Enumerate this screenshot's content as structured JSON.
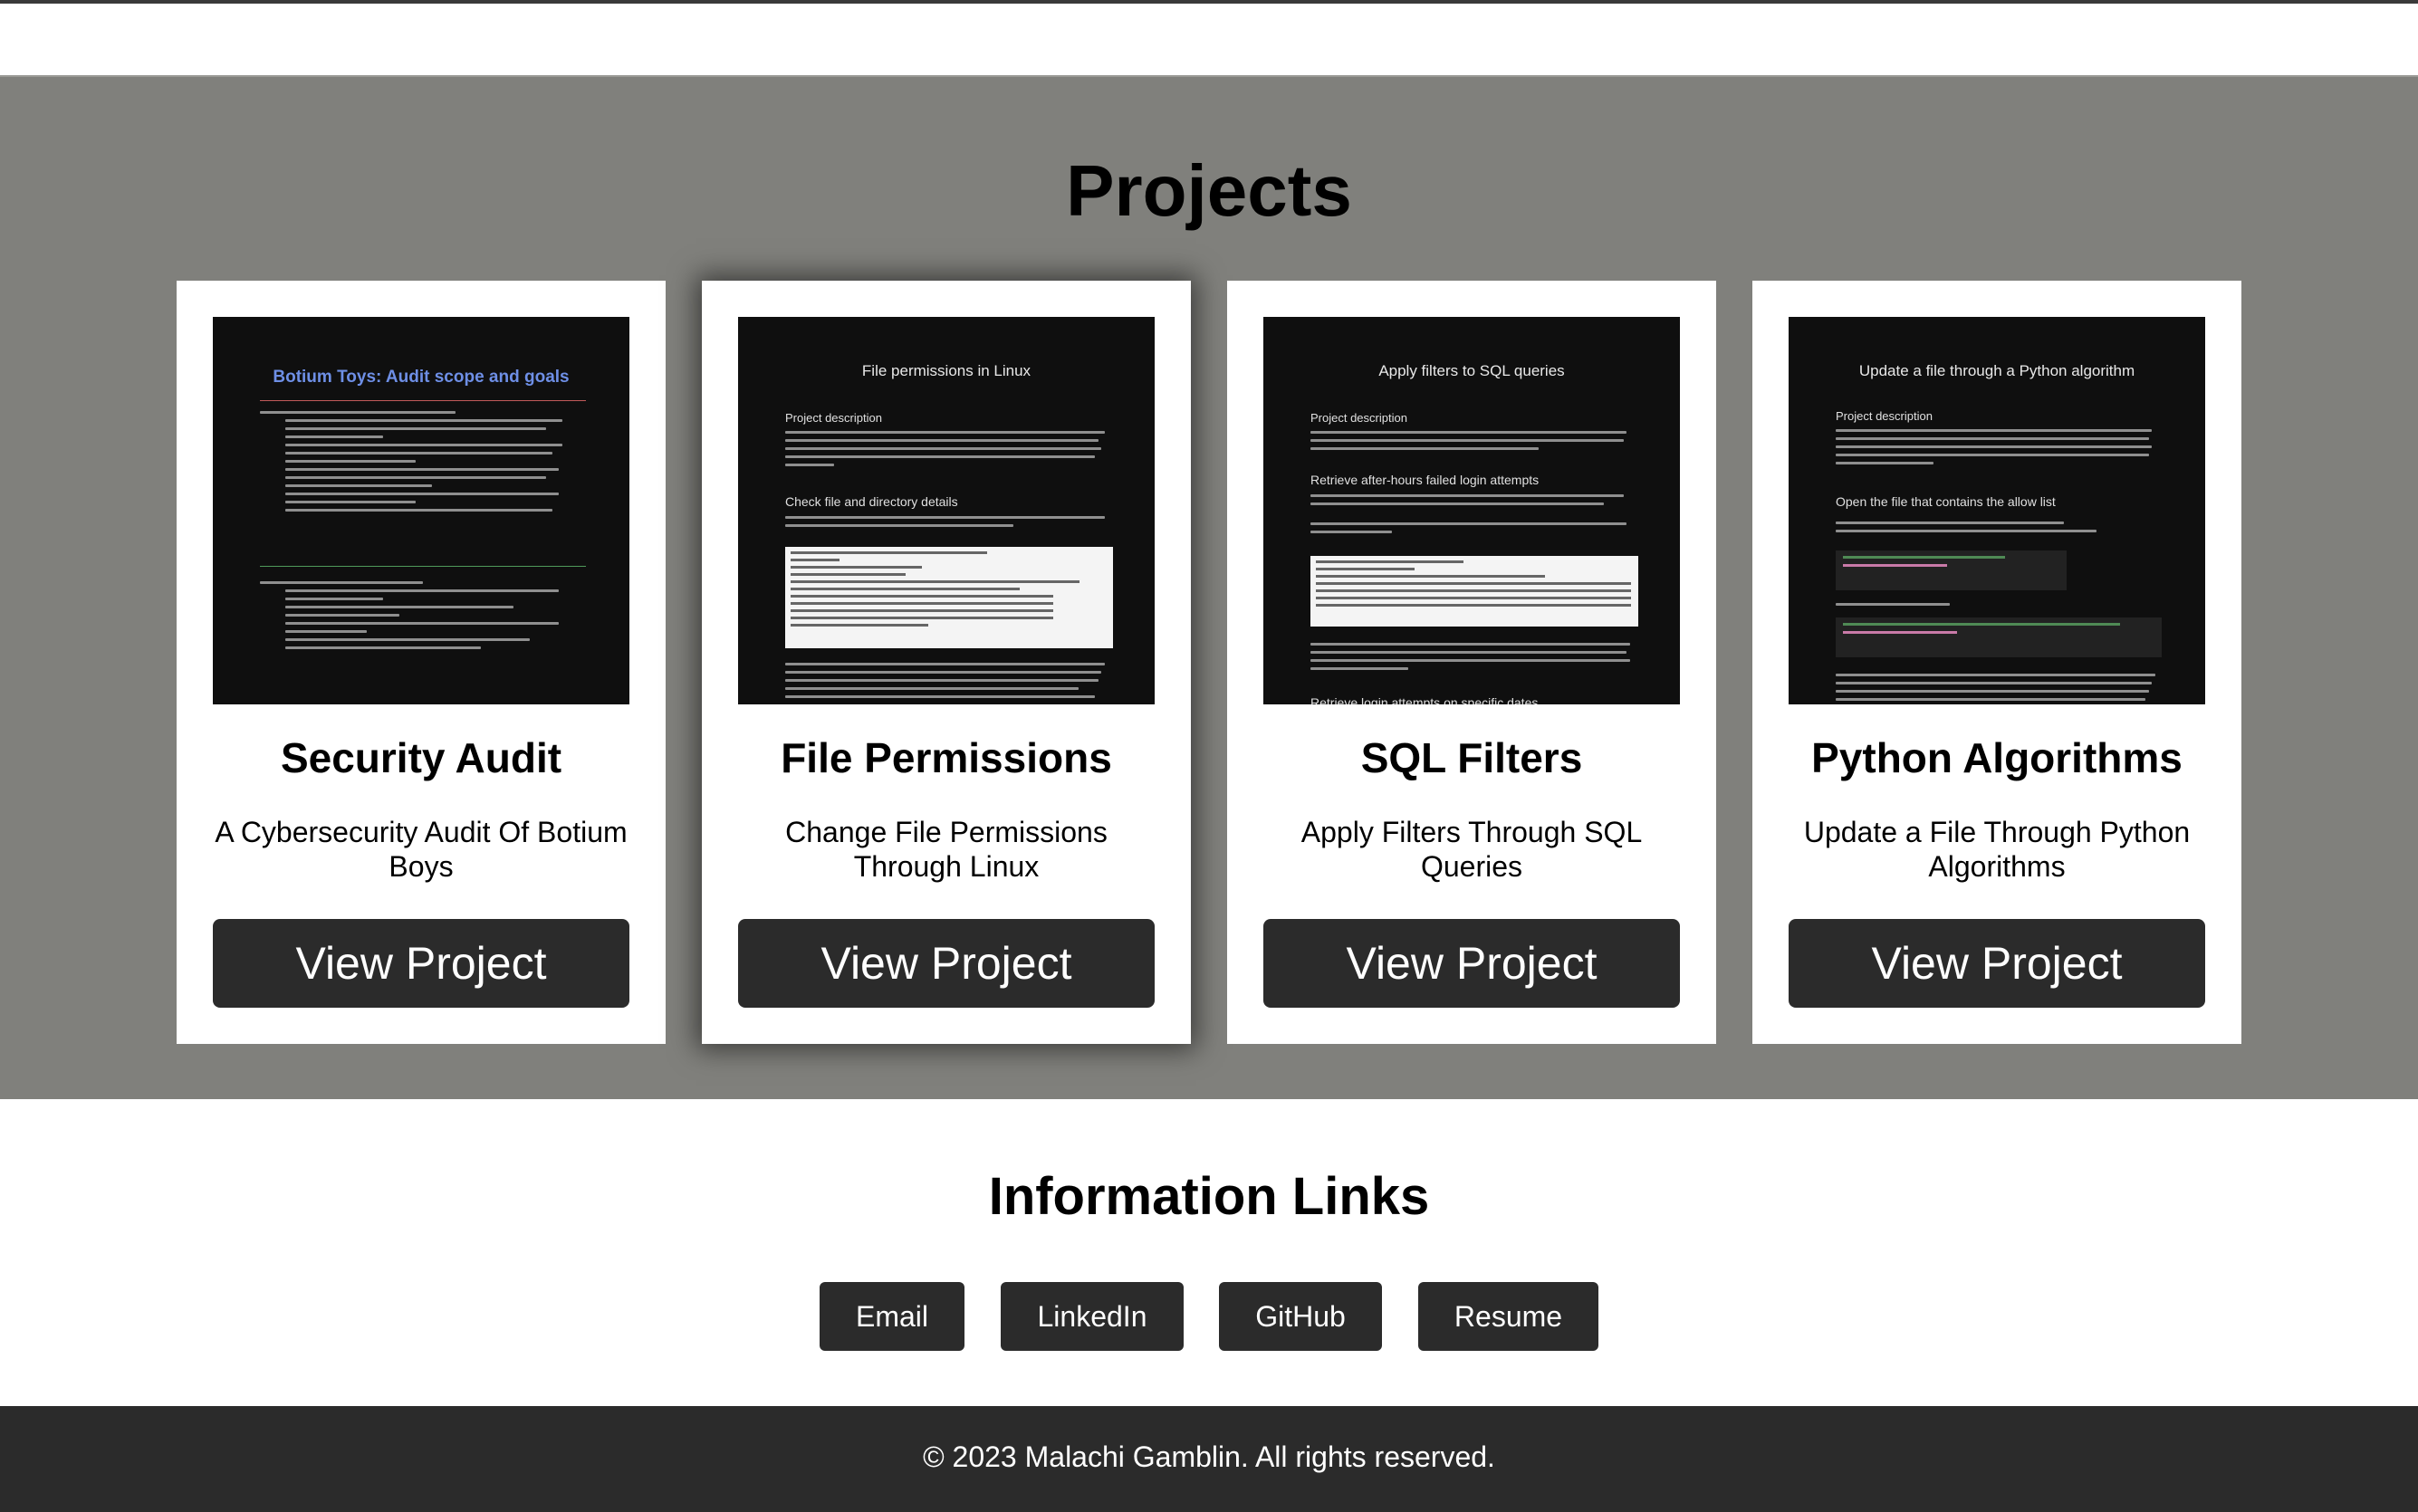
{
  "projects": {
    "heading": "Projects",
    "view_label": "View Project",
    "cards": [
      {
        "title": "Security Audit",
        "description": "A Cybersecurity Audit Of Botium Boys",
        "thumb_title": "Botium Toys: Audit scope and goals"
      },
      {
        "title": "File Permissions",
        "description": "Change File Permissions Through Linux",
        "thumb_title": "File permissions in Linux"
      },
      {
        "title": "SQL Filters",
        "description": "Apply Filters Through SQL Queries",
        "thumb_title": "Apply filters to SQL queries"
      },
      {
        "title": "Python Algorithms",
        "description": "Update a File Through Python Algorithms",
        "thumb_title": "Update a file through a Python algorithm"
      }
    ],
    "thumb_headings": {
      "file_1": "Project description",
      "file_2": "Check file and directory details",
      "sql_1": "Project description",
      "sql_2": "Retrieve after-hours failed login attempts",
      "sql_3": "Retrieve login attempts on specific dates",
      "py_1": "Project description",
      "py_2": "Open the file that contains the allow list"
    }
  },
  "links": {
    "heading": "Information Links",
    "email": "Email",
    "linkedin": "LinkedIn",
    "github": "GitHub",
    "resume": "Resume"
  },
  "footer": {
    "text": "© 2023 Malachi Gamblin. All rights reserved."
  },
  "colors": {
    "section_bg": "#80807c",
    "button_bg": "#2b2b2b",
    "footer_bg": "#2b2b2b",
    "thumb_bg": "#0f0f0f",
    "audit_title": "#6e8fe6"
  }
}
